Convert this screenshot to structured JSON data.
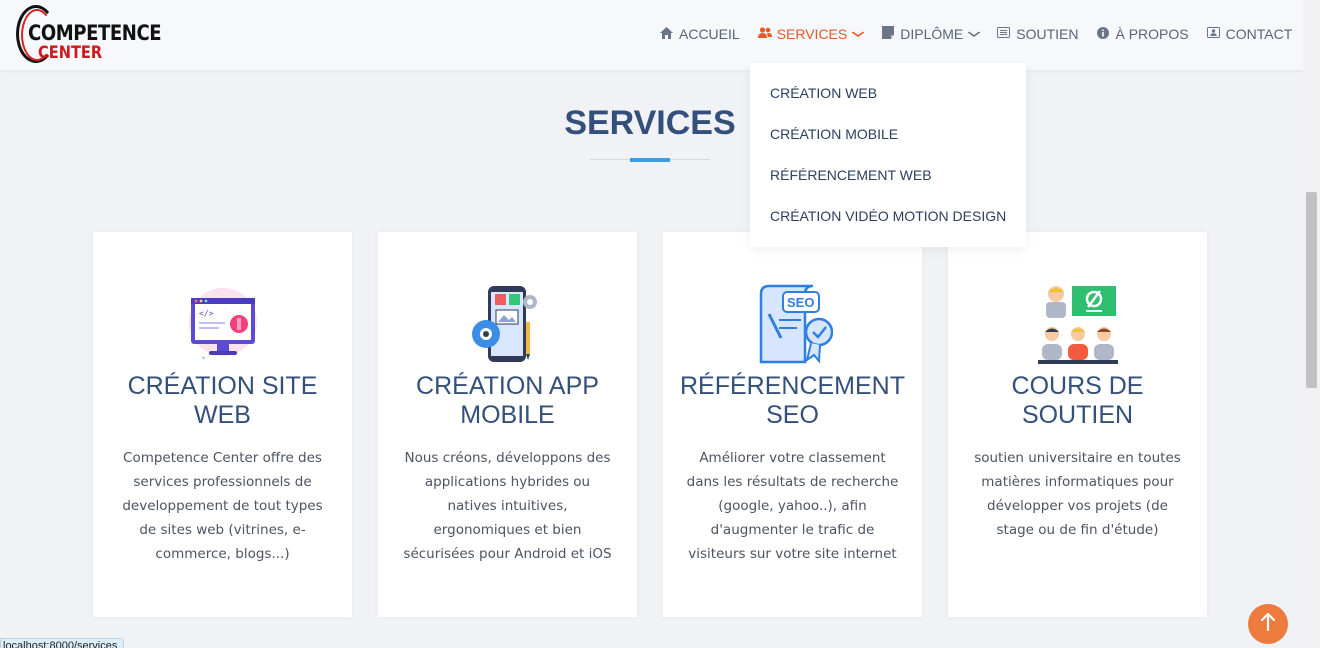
{
  "logo": {
    "line1": "COMPETENCE",
    "line2": "CENTER"
  },
  "nav": [
    {
      "label": "Accueil",
      "icon": "home-icon",
      "has_dropdown": false,
      "active": false
    },
    {
      "label": "Services",
      "icon": "users-icon",
      "has_dropdown": true,
      "active": true
    },
    {
      "label": "Diplôme",
      "icon": "document-icon",
      "has_dropdown": true,
      "active": false
    },
    {
      "label": "Soutien",
      "icon": "list-icon",
      "has_dropdown": false,
      "active": false
    },
    {
      "label": "À propos",
      "icon": "info-icon",
      "has_dropdown": false,
      "active": false
    },
    {
      "label": "Contact",
      "icon": "contact-card-icon",
      "has_dropdown": false,
      "active": false
    }
  ],
  "services_dropdown": [
    "Création web",
    "Création mobile",
    "Référencement web",
    "Création vidéo motion design"
  ],
  "section": {
    "title": "SERVICES"
  },
  "cards": [
    {
      "icon": "web-design-icon",
      "title": "Création site web",
      "text": "Competence Center offre des services professionnels de developpement de tout types de sites web (vitrines, e-commerce, blogs...)"
    },
    {
      "icon": "mobile-app-icon",
      "title": "Création app mobile",
      "text": "Nous créons, développons des applications hybrides ou natives intuitives, ergonomiques et bien sécurisées pour Android et iOS"
    },
    {
      "icon": "seo-certificate-icon",
      "title": "Référencement SEO",
      "text": "Améliorer votre classement dans les résultats de recherche (google, yahoo..), afin d'augmenter le trafic de visiteurs sur votre site internet"
    },
    {
      "icon": "classroom-icon",
      "title": "Cours de soutien",
      "text": "soutien universitaire en toutes matières informatiques pour développer vos projets (de stage ou de fin d'étude)"
    }
  ],
  "status_url": "localhost:8000/services",
  "colors": {
    "primary": "#34507a",
    "accent": "#e85a24",
    "line_accent": "#3a9ee0",
    "back_to_top": "#ee7b3e"
  }
}
